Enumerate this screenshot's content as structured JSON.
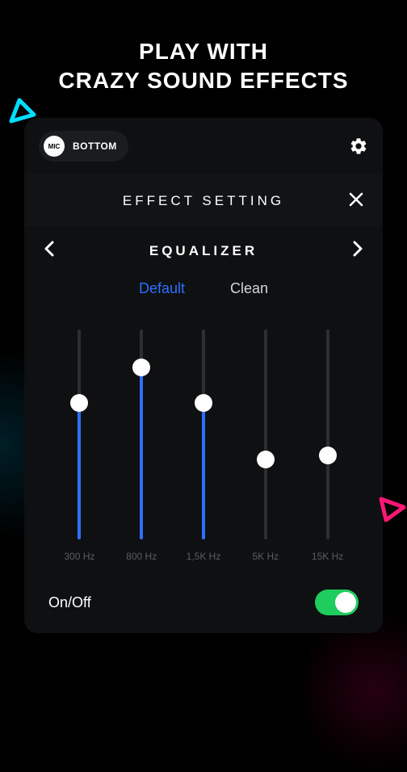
{
  "headline": {
    "line1": "PLAY WITH",
    "line2": "CRAZY SOUND EFFECTS"
  },
  "topbar": {
    "mic_badge": "MIC",
    "mic_label": "BOTTOM"
  },
  "section": {
    "title": "EFFECT SETTING"
  },
  "equalizer": {
    "title": "EQUALIZER",
    "presets": {
      "active": "Default",
      "inactive": "Clean"
    },
    "bands": [
      {
        "label": "300 Hz",
        "value": 65
      },
      {
        "label": "800 Hz",
        "value": 82
      },
      {
        "label": "1,5K Hz",
        "value": 65
      },
      {
        "label": "5K Hz",
        "value": 38
      },
      {
        "label": "15K Hz",
        "value": 40
      }
    ]
  },
  "toggle": {
    "label": "On/Off",
    "state": true
  }
}
